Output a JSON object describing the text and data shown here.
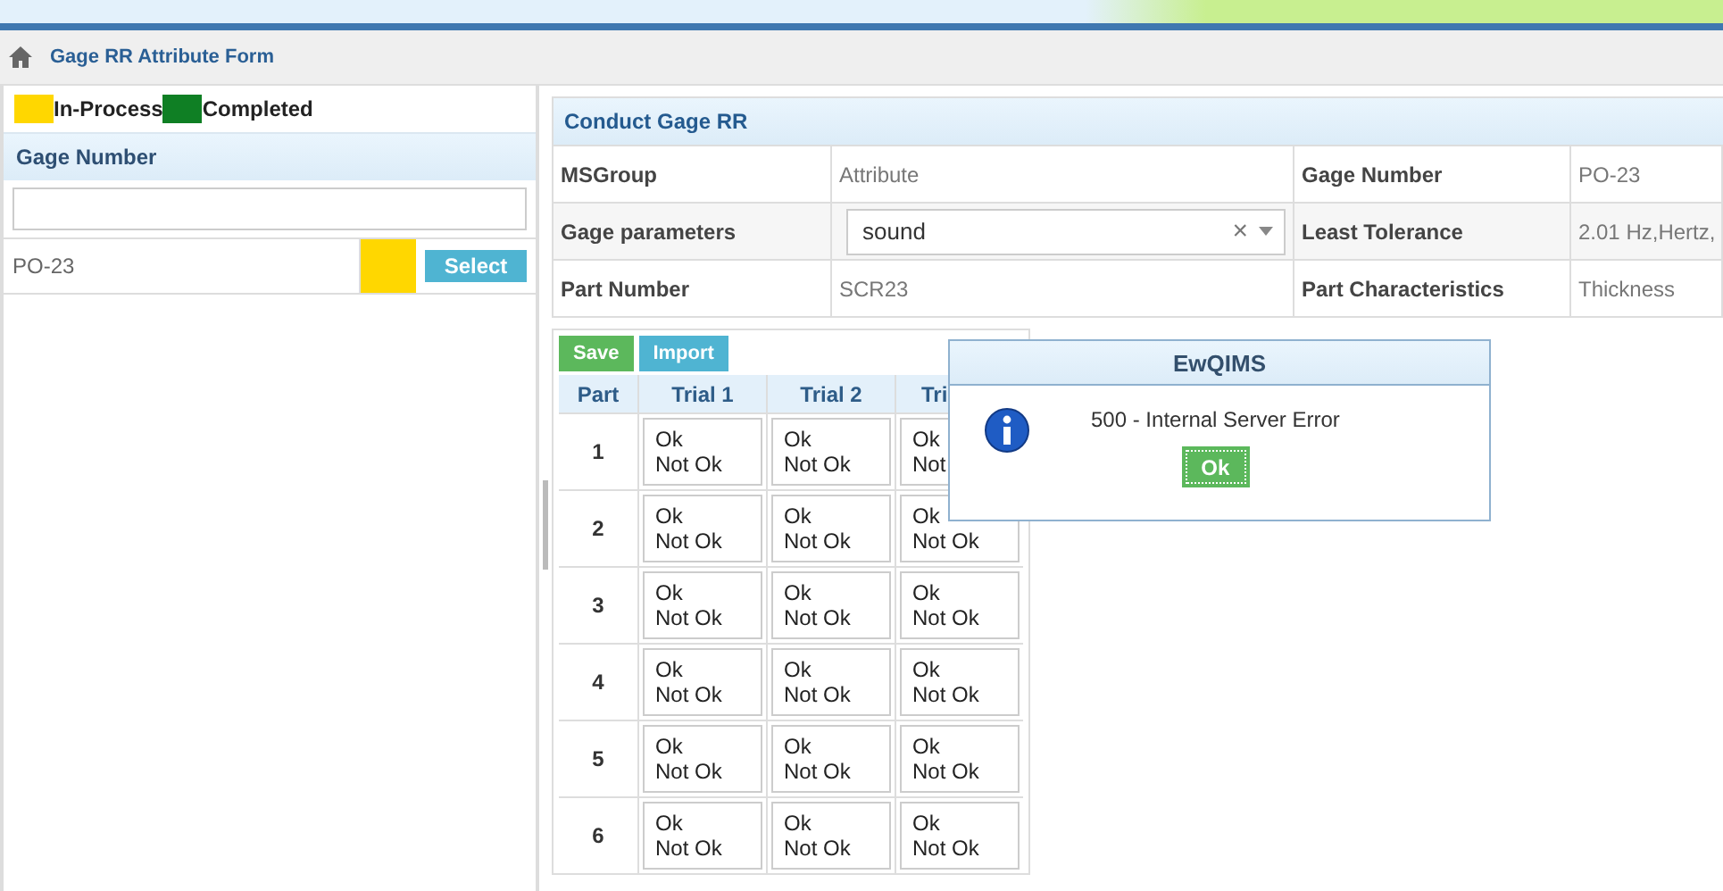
{
  "breadcrumb": {
    "title": "Gage RR Attribute Form"
  },
  "legend": [
    {
      "label": "In-Process",
      "color": "#ffd700"
    },
    {
      "label": "Completed",
      "color": "#0f7f24"
    }
  ],
  "gage_list": {
    "header": "Gage Number",
    "items": [
      {
        "number": "PO-23",
        "color": "#ffd700",
        "button": "Select"
      }
    ]
  },
  "conduct": {
    "title": "Conduct Gage RR",
    "fields": [
      {
        "label": "MSGroup",
        "value": "Attribute",
        "label2": "Gage Number",
        "value2": "PO-23"
      },
      {
        "label": "Gage parameters",
        "kind": "select",
        "value": "sound",
        "clear": "×",
        "label2": "Least Tolerance",
        "value2": "2.01 Hz,Hertz,"
      },
      {
        "label": "Part Number",
        "value": "SCR23",
        "label2": "Part Characteristics",
        "value2": "Thickness"
      }
    ]
  },
  "actions": [
    "Save",
    "Import"
  ],
  "trial_table": {
    "columns": [
      "Part",
      "Trial 1",
      "Trial 2",
      "Tri"
    ],
    "rows": [
      {
        "part": "1",
        "trial_1": [
          "Ok",
          "Not Ok"
        ],
        "trial_2": [
          "Ok",
          "Not Ok"
        ],
        "column_4": [
          "Ok",
          "Not"
        ]
      },
      {
        "part": "2",
        "trial_1": [
          "Ok",
          "Not Ok"
        ],
        "trial_2": [
          "Ok",
          "Not Ok"
        ],
        "column_4": [
          "Ok",
          "Not Ok"
        ]
      },
      {
        "part": "3",
        "trial_1": [
          "Ok",
          "Not Ok"
        ],
        "trial_2": [
          "Ok",
          "Not Ok"
        ],
        "column_4": [
          "Ok",
          "Not Ok"
        ]
      },
      {
        "part": "4",
        "trial_1": [
          "Ok",
          "Not Ok"
        ],
        "trial_2": [
          "Ok",
          "Not Ok"
        ],
        "column_4": [
          "Ok",
          "Not Ok"
        ]
      },
      {
        "part": "5",
        "trial_1": [
          "Ok",
          "Not Ok"
        ],
        "trial_2": [
          "Ok",
          "Not Ok"
        ],
        "column_4": [
          "Ok",
          "Not Ok"
        ]
      },
      {
        "part": "6",
        "trial_1": [
          "Ok",
          "Not Ok"
        ],
        "trial_2": [
          "Ok",
          "Not Ok"
        ],
        "column_4": [
          "Ok",
          "Not Ok"
        ]
      }
    ]
  },
  "dialog": {
    "title": "EwQIMS",
    "message": "500 - Internal Server Error",
    "button": "Ok"
  }
}
